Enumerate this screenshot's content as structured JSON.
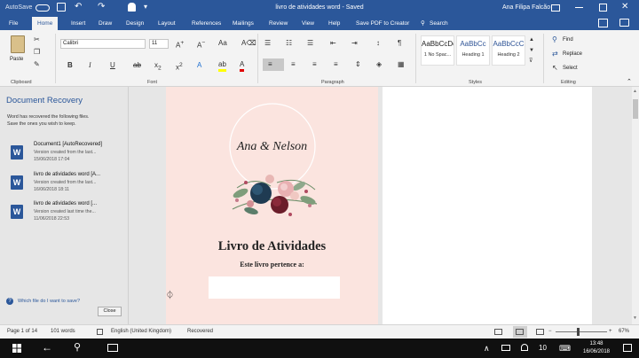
{
  "titlebar": {
    "autosave": "AutoSave",
    "title": "livro de atividades word - Saved",
    "user": "Ana Filipa Falcão"
  },
  "tabs": [
    "File",
    "Home",
    "Insert",
    "Draw",
    "Design",
    "Layout",
    "References",
    "Mailings",
    "Review",
    "View",
    "Help",
    "Save PDF to Creator"
  ],
  "tell_me": "Search",
  "ribbon": {
    "paste_label": "Paste",
    "clipboard": "Clipboard",
    "font_name": "Calibri",
    "font_size": "11",
    "font": "Font",
    "paragraph": "Paragraph",
    "styles_group": "Styles",
    "editing": "Editing",
    "find": "Find",
    "replace": "Replace",
    "select": "Select",
    "styles": [
      {
        "sample": "AaBbCcDc",
        "name": "1 No Spac..."
      },
      {
        "sample": "AaBbCc",
        "name": "Heading 1"
      },
      {
        "sample": "AaBbCcC",
        "name": "Heading 2"
      }
    ]
  },
  "recovery": {
    "title": "Document Recovery",
    "desc1": "Word has recovered the following files.",
    "desc2": "Save the ones you wish to keep.",
    "items": [
      {
        "name": "Document1 [AutoRecovered]",
        "line1": "Version created from the last...",
        "line2": "15/06/2018 17:04"
      },
      {
        "name": "livro de atividades word [A...",
        "line1": "Version created from the last...",
        "line2": "16/06/2018 18:11"
      },
      {
        "name": "livro de atividades word [...",
        "line1": "Version created last time the...",
        "line2": "11/06/2018 22:53"
      }
    ],
    "question": "Which file do I want to save?",
    "close": "Close"
  },
  "document": {
    "names": "Ana & Nelson",
    "heading": "Livro de Atividades",
    "subheading": "Este livro pertence a:"
  },
  "status": {
    "page": "Page 1 of 14",
    "words": "101 words",
    "language": "English (United Kingdom)",
    "recovered": "Recovered",
    "zoom": "67%"
  },
  "taskbar": {
    "time": "13:48",
    "date": "16/06/2018",
    "battery_count": "10"
  }
}
